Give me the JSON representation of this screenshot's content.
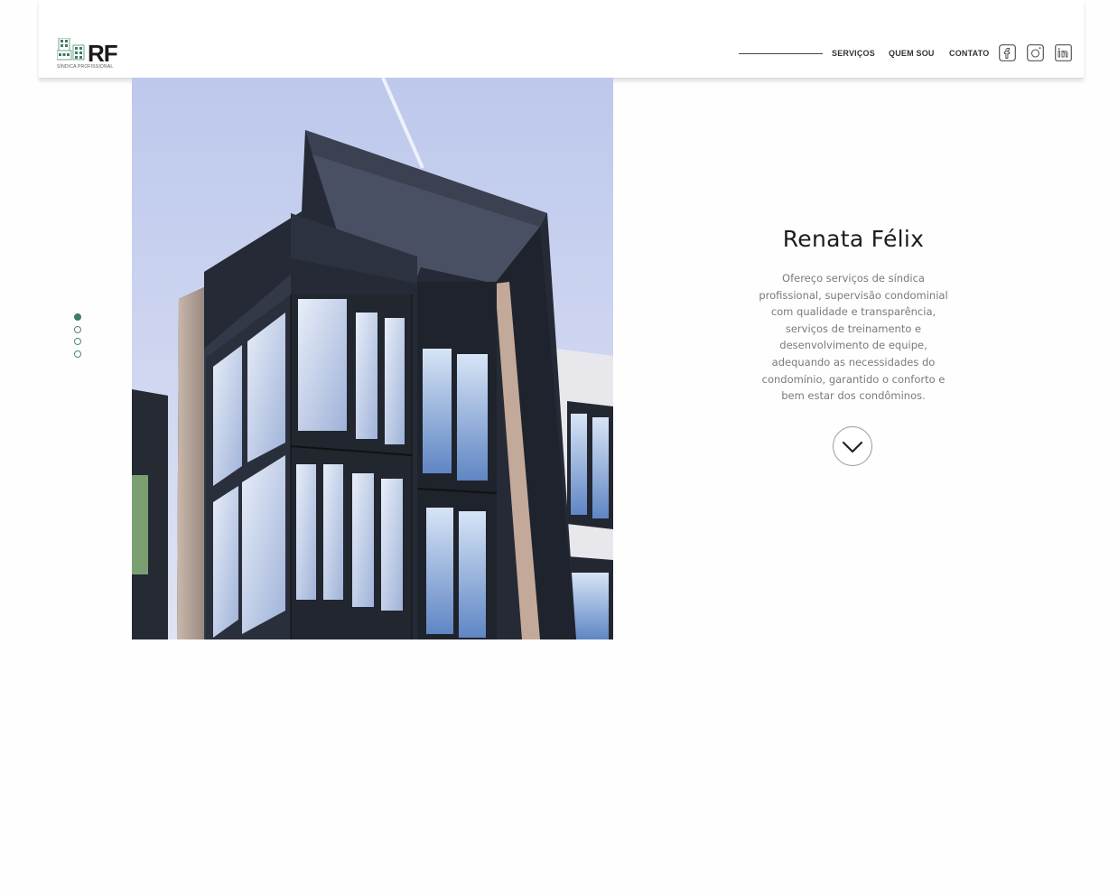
{
  "brand": {
    "logo_text": "RF",
    "tagline": "SÍNDICA PROFISSIONAL"
  },
  "nav": {
    "items": [
      {
        "label": "SERVIÇOS"
      },
      {
        "label": "QUEM SOU"
      },
      {
        "label": "CONTATO"
      }
    ],
    "social": [
      {
        "icon": "facebook-icon"
      },
      {
        "icon": "instagram-icon"
      },
      {
        "icon": "linkedin-icon"
      }
    ]
  },
  "intro": {
    "title": "Renata Félix",
    "text": "Ofereço serviços de síndica profissional, supervisão condominial com qualidade e transparência, serviços de treinamento e desenvolvimento de equipe, adequando as necessidades do condomínio, garantido o conforto e bem estar dos condôminos."
  },
  "slider": {
    "total": 4,
    "active_index": 0
  },
  "scroll_button": {
    "icon": "chevron-down-icon"
  },
  "colors": {
    "accent": "#3e7d60",
    "sky": "#c9d4ef",
    "facade": "#2a2f3c"
  }
}
